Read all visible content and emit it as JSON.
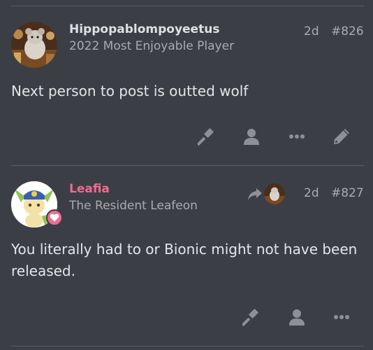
{
  "posts": [
    {
      "username": "Hippopablompoyeetus",
      "user_title": "2022 Most Enjoyable Player",
      "time": "2d",
      "post_number": "#826",
      "body": "Next person to post is outted wolf",
      "username_color": "#dfe0e2"
    },
    {
      "username": "Leafia",
      "user_title": "The Resident Leafeon",
      "time": "2d",
      "post_number": "#827",
      "body": "You literally had to or Bionic might not have been released.",
      "username_color": "#ef6b8f"
    }
  ],
  "colors": {
    "background": "#3b3f45",
    "icon": "#8d9096",
    "accent_pink": "#ef6b8f"
  }
}
